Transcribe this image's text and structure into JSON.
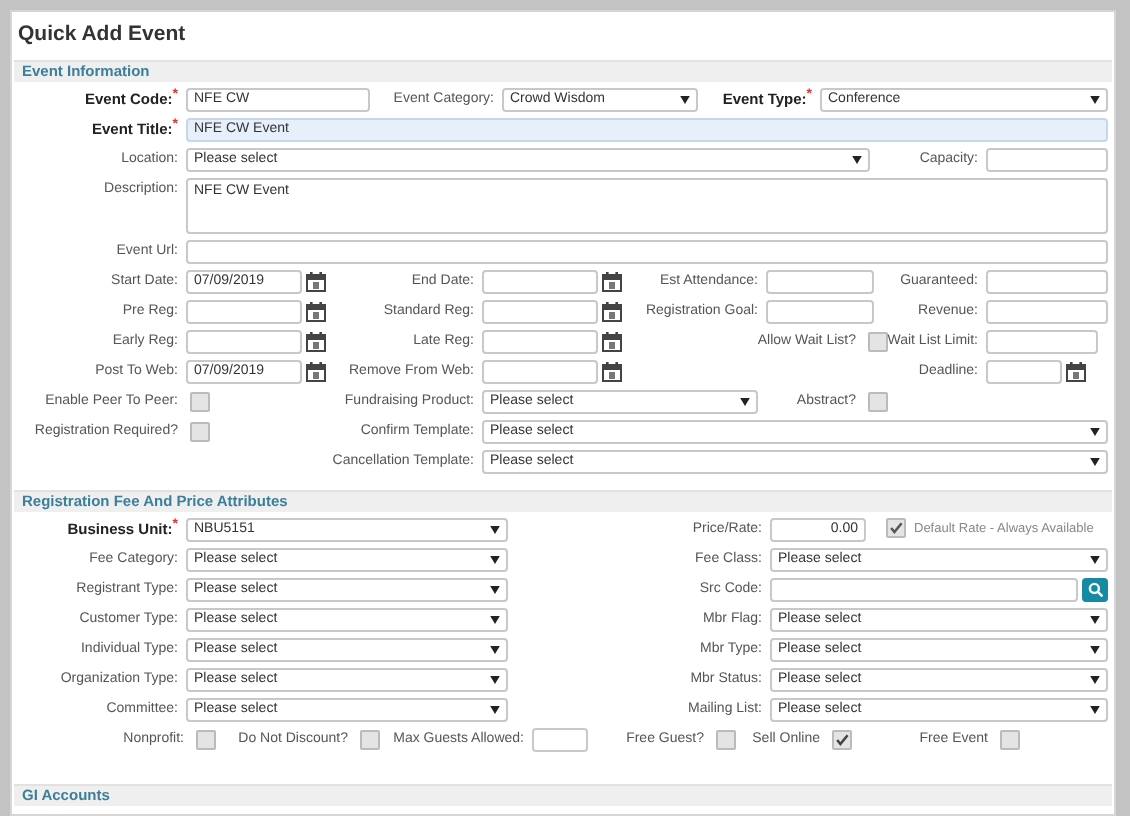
{
  "title": "Quick Add Event",
  "sections": [
    {
      "title": "Event Information",
      "lines": [
        {
          "fields": [
            {
              "label": "Event Code:",
              "required_mark": "*",
              "kind": "input",
              "value": "NFE CW"
            },
            {
              "label": "Event Category:",
              "kind": "select",
              "value": "Crowd Wisdom"
            },
            {
              "label": "Event Type:",
              "required_mark": "*",
              "kind": "select",
              "value": "Conference"
            }
          ]
        },
        {
          "fields": [
            {
              "label": "Event Title:",
              "required_mark": "*",
              "kind": "input",
              "value": "NFE CW Event",
              "highlighted": true
            }
          ]
        },
        {
          "fields": [
            {
              "label": "Location:",
              "kind": "select",
              "value": "Please select"
            },
            {
              "label": "Capacity:",
              "kind": "input"
            }
          ]
        },
        {
          "fields": [
            {
              "label": "Description:",
              "kind": "textarea",
              "value": "NFE CW Event"
            }
          ]
        },
        {
          "fields": [
            {
              "label": "Event Url:",
              "kind": "input"
            }
          ]
        },
        {
          "fields": [
            {
              "label": "Start Date:",
              "kind": "date",
              "value": "07/09/2019"
            },
            {
              "label": "End Date:",
              "kind": "date"
            },
            {
              "label": "Est Attendance:",
              "kind": "input"
            },
            {
              "label": "Guaranteed:",
              "kind": "input"
            }
          ]
        },
        {
          "fields": [
            {
              "label": "Pre Reg:",
              "kind": "date"
            },
            {
              "label": "Standard Reg:",
              "kind": "date"
            },
            {
              "label": "Registration Goal:",
              "kind": "input"
            },
            {
              "label": "Revenue:",
              "kind": "input"
            }
          ]
        },
        {
          "fields": [
            {
              "label": "Early Reg:",
              "kind": "date"
            },
            {
              "label": "Late Reg:",
              "kind": "date"
            },
            {
              "label": "Allow Wait List?",
              "kind": "checkbox",
              "checked": false
            },
            {
              "label": "Wait List Limit:",
              "kind": "input"
            }
          ]
        },
        {
          "fields": [
            {
              "label": "Post To Web:",
              "kind": "date",
              "value": "07/09/2019"
            },
            {
              "label": "Remove From Web:",
              "kind": "date"
            },
            {
              "label": "Deadline:",
              "kind": "date"
            }
          ]
        },
        {
          "fields": [
            {
              "label": "Enable Peer To Peer:",
              "kind": "checkbox",
              "checked": false
            },
            {
              "label": "Fundraising Product:",
              "kind": "select",
              "value": "Please select"
            },
            {
              "label": "Abstract?",
              "kind": "checkbox",
              "checked": false
            }
          ]
        },
        {
          "fields": [
            {
              "label": "Registration Required?",
              "kind": "checkbox",
              "checked": false
            },
            {
              "label": "Confirm Template:",
              "kind": "select",
              "value": "Please select"
            }
          ]
        },
        {
          "fields": [
            {
              "label": "Cancellation Template:",
              "kind": "select",
              "value": "Please select"
            }
          ]
        }
      ]
    },
    {
      "title": "Registration Fee And Price Attributes",
      "lines": [
        {
          "fields": [
            {
              "label": "Business Unit:",
              "required_mark": "*",
              "kind": "select",
              "value": "NBU5151"
            },
            {
              "label": "Price/Rate:",
              "kind": "number",
              "value": "0.00"
            },
            {
              "label": "Default Rate - Always Available",
              "kind": "check-after",
              "checked": true
            }
          ]
        },
        {
          "fields": [
            {
              "label": "Fee Category:",
              "kind": "select",
              "value": "Please select"
            },
            {
              "label": "Fee Class:",
              "kind": "select",
              "value": "Please select"
            }
          ]
        },
        {
          "fields": [
            {
              "label": "Registrant Type:",
              "kind": "select",
              "value": "Please select"
            },
            {
              "label": "Src Code:",
              "kind": "search"
            }
          ]
        },
        {
          "fields": [
            {
              "label": "Customer Type:",
              "kind": "select",
              "value": "Please select"
            },
            {
              "label": "Mbr Flag:",
              "kind": "select",
              "value": "Please select"
            }
          ]
        },
        {
          "fields": [
            {
              "label": "Individual Type:",
              "kind": "select",
              "value": "Please select"
            },
            {
              "label": "Mbr Type:",
              "kind": "select",
              "value": "Please select"
            }
          ]
        },
        {
          "fields": [
            {
              "label": "Organization Type:",
              "kind": "select",
              "value": "Please select"
            },
            {
              "label": "Mbr Status:",
              "kind": "select",
              "value": "Please select"
            }
          ]
        },
        {
          "fields": [
            {
              "label": "Committee:",
              "kind": "select",
              "value": "Please select"
            },
            {
              "label": "Mailing List:",
              "kind": "select",
              "value": "Please select"
            }
          ]
        },
        {
          "fields": [
            {
              "label": "Nonprofit:",
              "kind": "checkbox",
              "checked": false
            },
            {
              "label": "Do Not Discount?",
              "kind": "checkbox",
              "checked": false
            },
            {
              "label": "Max Guests Allowed:",
              "kind": "input"
            },
            {
              "label": "Free Guest?",
              "kind": "checkbox",
              "checked": false
            },
            {
              "label": "Sell Online",
              "kind": "checkbox",
              "checked": true
            },
            {
              "label": "Free Event",
              "kind": "checkbox",
              "checked": false
            }
          ]
        }
      ]
    },
    {
      "title": "GI Accounts"
    }
  ]
}
